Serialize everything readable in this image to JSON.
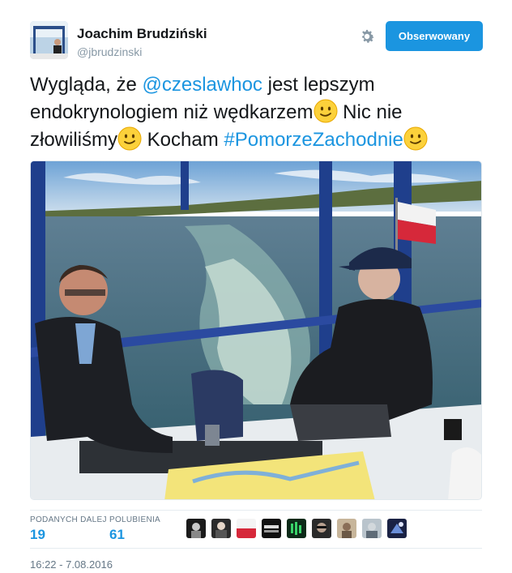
{
  "author": {
    "name": "Joachim Brudziński",
    "handle": "@jbrudzinski"
  },
  "follow_button": {
    "label": "Obserwowany"
  },
  "tweet": {
    "text_1": "Wygląda, że ",
    "mention": "@czeslawhoc",
    "text_2": " jest lepszym endokrynologiem niż wędkarzem",
    "text_3": " Nic nie złowiliśmy",
    "text_4": " Kocham ",
    "hashtag": "#PomorzeZachodnie"
  },
  "stats": {
    "retweets_label": "PODANYCH DALEJ",
    "retweets_count": "19",
    "likes_label": "POLUBIENIA",
    "likes_count": "61"
  },
  "liker_avatars": [
    "liker-avatar-1",
    "liker-avatar-2",
    "liker-avatar-3",
    "liker-avatar-4",
    "liker-avatar-5",
    "liker-avatar-6",
    "liker-avatar-7",
    "liker-avatar-8",
    "liker-avatar-9"
  ],
  "timestamp": "16:22 - 7.08.2016",
  "colors": {
    "link": "#1b95e0",
    "button": "#1b95e0",
    "muted": "#657786"
  },
  "icons": {
    "settings": "gear-icon",
    "emoji": "slightly-smiling-face-emoji"
  }
}
